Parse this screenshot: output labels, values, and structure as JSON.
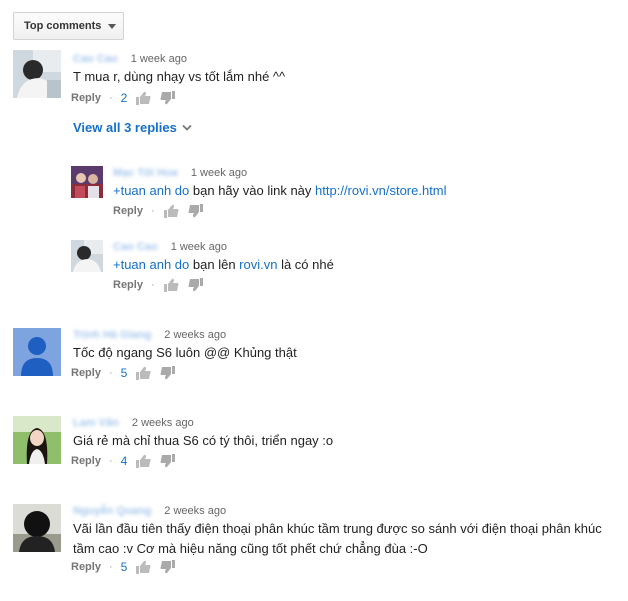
{
  "sort": {
    "label": "Top comments"
  },
  "view_replies": {
    "label": "View all 3 replies"
  },
  "reply_label": "Reply",
  "comments": [
    {
      "author": "Cao Cao",
      "time": "1 week ago",
      "text": "T mua r, dùng nhạy vs tốt lắm nhé ^^",
      "likes": "2",
      "avatar": "photo-man-white-shirt"
    },
    {
      "author": "Mạc Tôi Hoa",
      "time": "1 week ago",
      "mention": "+tuan anh do",
      "text": " bạn hãy vào link này ",
      "link": "http://rovi.vn/store.html",
      "avatar": "photo-group-purple"
    },
    {
      "author": "Cao Cao",
      "time": "1 week ago",
      "mention": "+tuan anh do",
      "text": " bạn lên ",
      "link": "rovi.vn",
      "text2": " là có nhé",
      "avatar": "photo-man-white-shirt"
    },
    {
      "author": "Trịnh Hà Giang",
      "time": "2 weeks ago",
      "text": "Tốc độ ngang S6 luôn @@ Khủng thật",
      "likes": "5",
      "avatar": "default-user-icon"
    },
    {
      "author": "Lam Vân",
      "time": "2 weeks ago",
      "text": "Giá rẻ mà chỉ thua S6 có tý thôi, triển ngay :o",
      "likes": "4",
      "avatar": "photo-girl-green"
    },
    {
      "author": "Nguyễn Quang",
      "time": "2 weeks ago",
      "text": "Vãi lần đầu tiên thấy điện thoại phân khúc tầm trung được so sánh với điện thoại phân khúc tầm cao :v Cơ mà hiệu năng cũng tốt phết chứ chẳng đùa :-O",
      "likes": "5",
      "avatar": "photo-silhouette"
    }
  ],
  "colors": {
    "link": "#1670c9",
    "avatar_default_bg": "#7da4de"
  }
}
